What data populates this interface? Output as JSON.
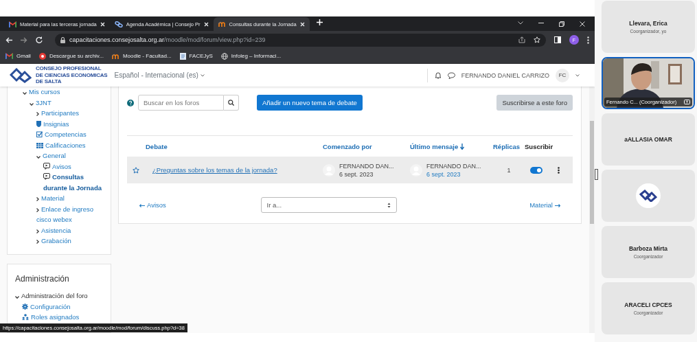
{
  "browser": {
    "tabs": [
      {
        "title": "Material para las terceras jornada",
        "kind": "mail",
        "selected": false
      },
      {
        "title": "Agenda Académica | Consejo Pr",
        "kind": "link",
        "selected": false
      },
      {
        "title": "Consultas durante la Jornada",
        "kind": "moodle",
        "selected": true
      }
    ],
    "address": {
      "host": "capacitaciones.consejosalta.org.ar",
      "path": "/moodle/mod/forum/view.php?id=239"
    },
    "profile": "F",
    "bookmarks": [
      {
        "label": "Gmail",
        "kind": "mail"
      },
      {
        "label": "Descargue su archiv...",
        "kind": "red"
      },
      {
        "label": "Moodle - Facultad...",
        "kind": "moodle"
      },
      {
        "label": "FACEJyS",
        "kind": "doc"
      },
      {
        "label": "Infoleg – Informaci...",
        "kind": "globe"
      }
    ],
    "status_link": "https://capacitaciones.consejosalta.org.ar/moodle/mod/forum/discuss.php?d=38"
  },
  "site_header": {
    "logo_lines": [
      "CONSEJO PROFESIONAL",
      "DE CIENCIAS ECONOMICAS",
      "DE SALTA"
    ],
    "language": "Español - Internacional (es)",
    "user_name": "FERNANDO DANIEL CARRIZO",
    "user_initials": "FC"
  },
  "navigation": {
    "items": [
      {
        "label": "Mis cursos",
        "kind": "caret",
        "expanded": true,
        "selected": false,
        "children": [
          {
            "label": "3JNT",
            "kind": "caret",
            "expanded": true,
            "selected": false,
            "children": [
              {
                "label": "Participantes",
                "kind": "caret",
                "expanded": false,
                "selected": false
              },
              {
                "label": "Insignias",
                "kind": "shield",
                "selected": false
              },
              {
                "label": "Competencias",
                "kind": "check",
                "selected": false
              },
              {
                "label": "Calificaciones",
                "kind": "table",
                "selected": false
              },
              {
                "label": "General",
                "kind": "caret",
                "expanded": true,
                "selected": false,
                "children": [
                  {
                    "label": "Avisos",
                    "kind": "forum",
                    "selected": false
                  },
                  {
                    "label": "Consultas durante la Jornada",
                    "kind": "forum",
                    "selected": true
                  }
                ]
              },
              {
                "label": "Material",
                "kind": "caret",
                "expanded": false,
                "selected": false
              },
              {
                "label": "Enlace de ingreso cisco webex",
                "kind": "caret",
                "expanded": false,
                "selected": false
              },
              {
                "label": "Asistencia",
                "kind": "caret",
                "expanded": false,
                "selected": false
              },
              {
                "label": "Grabación",
                "kind": "caret",
                "expanded": false,
                "selected": false
              }
            ]
          }
        ]
      }
    ]
  },
  "administration": {
    "title": "Administración",
    "items": [
      {
        "label": "Administración del foro",
        "kind": "caret",
        "expanded": true,
        "selected": false,
        "children": [
          {
            "label": "Configuración",
            "kind": "gear",
            "selected": false
          },
          {
            "label": "Roles asignados",
            "kind": "users",
            "selected": false
          }
        ]
      }
    ]
  },
  "forum": {
    "search_placeholder": "Buscar en los foros",
    "add_button": "Añadir un nuevo tema de debate",
    "subscribe_button": "Suscribirse a este foro",
    "columns": [
      {
        "label": "Debate",
        "kind": "link",
        "sorted": false
      },
      {
        "label": "Comenzado por",
        "kind": "link",
        "sorted": false
      },
      {
        "label": "Último mensaje",
        "kind": "link",
        "sorted": true
      },
      {
        "label": "Réplicas",
        "kind": "link",
        "sorted": false
      },
      {
        "label": "Suscribir",
        "kind": "plain",
        "sorted": false
      }
    ],
    "rows": [
      {
        "starred": false,
        "title": "¿Preguntas sobre los temas de la jornada?",
        "started_by": {
          "name": "FERNANDO DAN...",
          "date": "6 sept. 2023"
        },
        "last_post": {
          "name": "FERNANDO DAN...",
          "date": "6 sept. 2023"
        },
        "replies": "1",
        "subscribed": true
      }
    ],
    "previous": "Avisos",
    "jump_value": "Ir a...",
    "next": "Material"
  },
  "participants": [
    {
      "kind": "name",
      "name": "Llevara, Erica",
      "role": "Coorganizador, yo",
      "selected": false
    },
    {
      "kind": "video",
      "label": "Fernando C... (Coorganizador)",
      "selected": true
    },
    {
      "kind": "name",
      "name": "aALLASIA OMAR",
      "selected": false
    },
    {
      "kind": "logo",
      "selected": false
    },
    {
      "kind": "name",
      "name": "Barboza Mirta",
      "role": "Coorganizador",
      "selected": false
    },
    {
      "kind": "name",
      "name": "ARACELI CPCES",
      "role": "Coorganizador",
      "selected": false
    }
  ]
}
